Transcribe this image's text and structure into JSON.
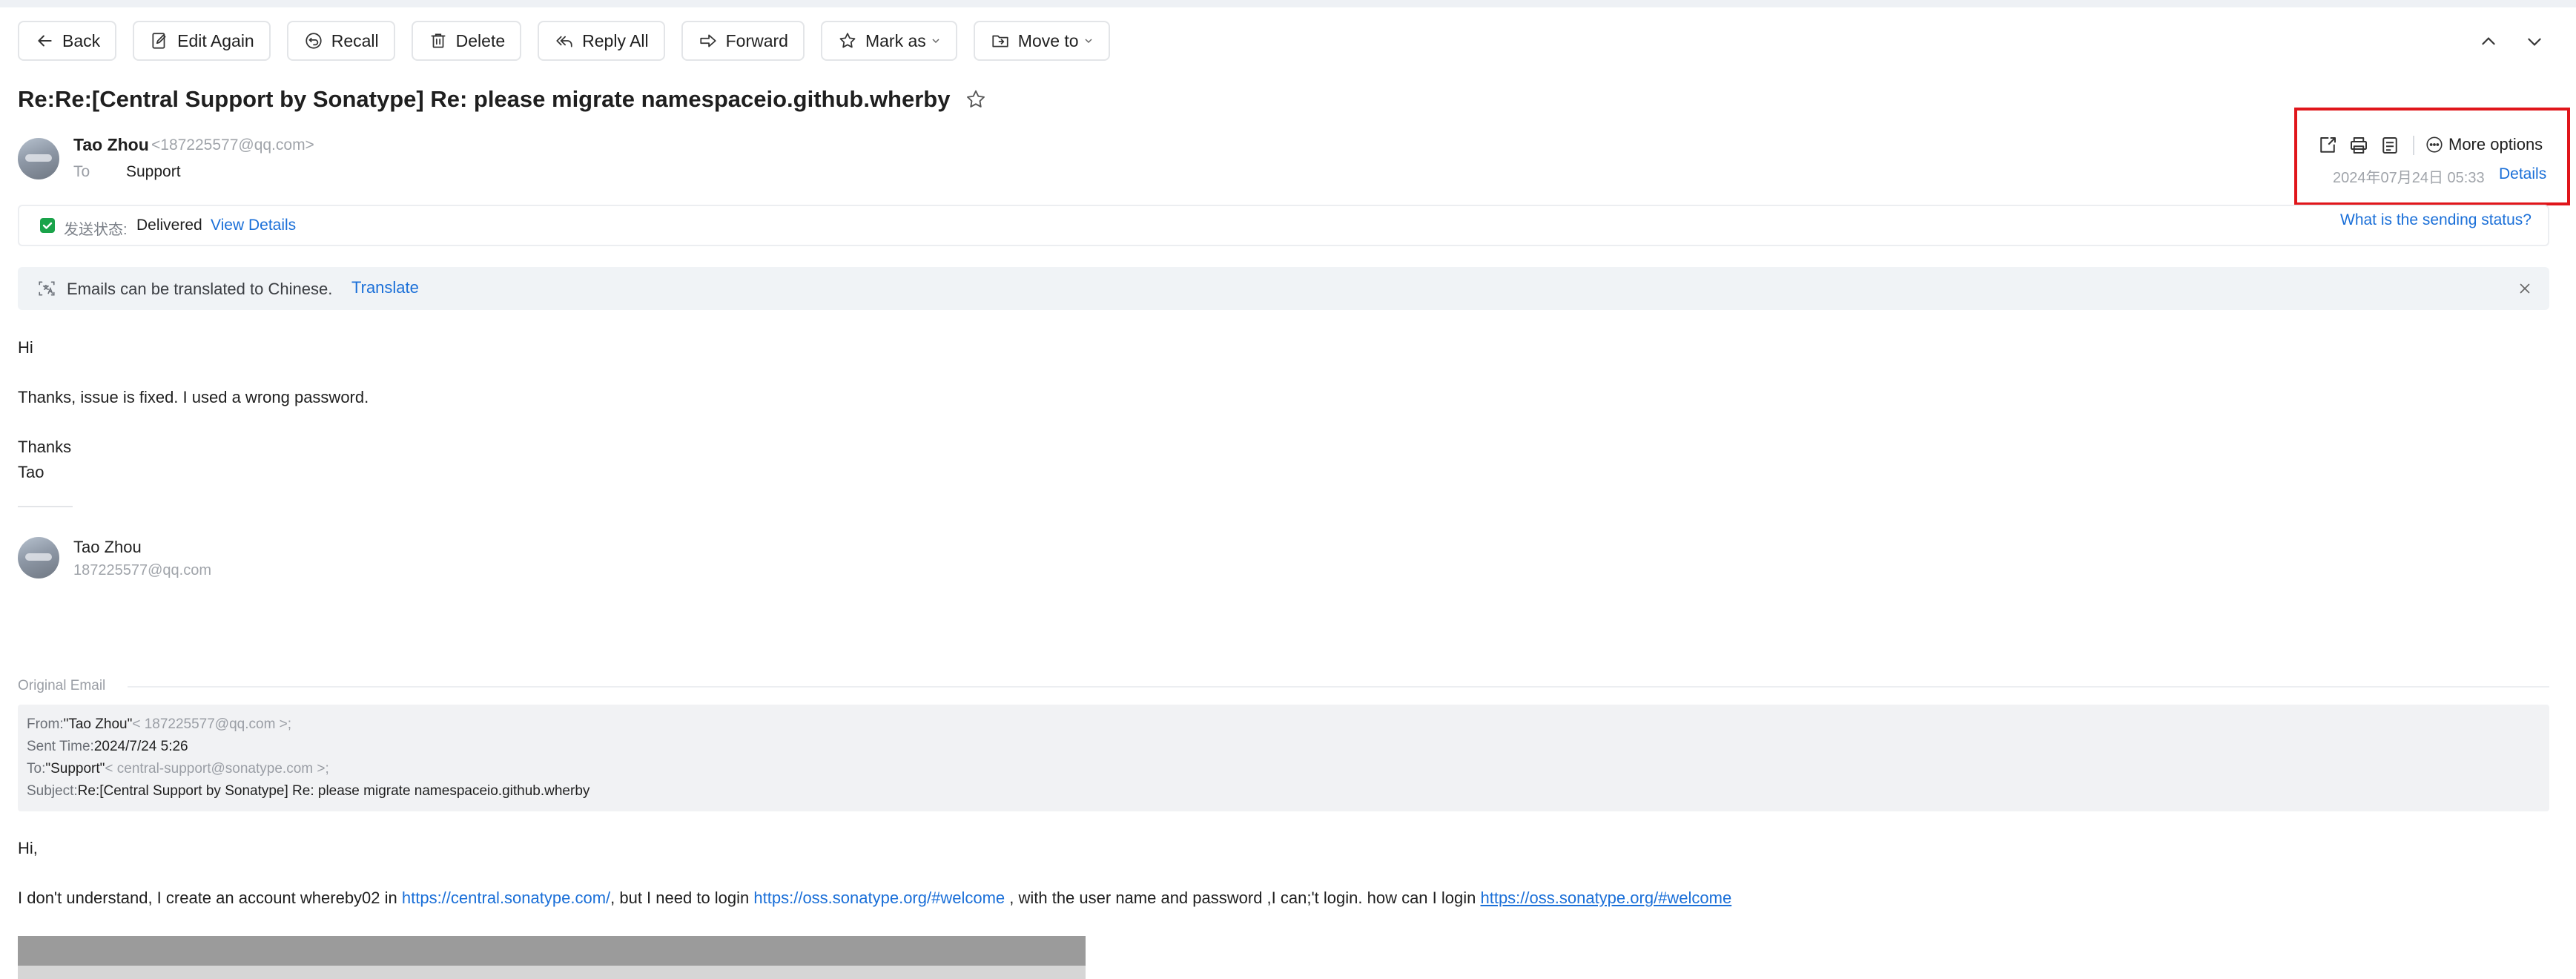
{
  "toolbar": {
    "back": "Back",
    "edit_again": "Edit Again",
    "recall": "Recall",
    "delete": "Delete",
    "reply_all": "Reply All",
    "forward": "Forward",
    "mark_as": "Mark as",
    "move_to": "Move to"
  },
  "email": {
    "subject": "Re:Re:[Central Support by Sonatype] Re: please migrate namespaceio.github.wherby",
    "sender_name": "Tao Zhou",
    "sender_email": "<187225577@qq.com>",
    "to_label": "To",
    "to_value": "Support",
    "more_options": "More options",
    "date": "2024年07月24日 05:33",
    "details": "Details"
  },
  "status": {
    "label": "发送状态:",
    "value": "Delivered",
    "view_details": "View Details",
    "sending_status_link": "What is the sending status?"
  },
  "translate": {
    "text": "Emails can be translated to Chinese.",
    "link": "Translate"
  },
  "body": {
    "greeting": "Hi",
    "line1": "Thanks, issue is fixed. I used a wrong password.",
    "thanks": "Thanks",
    "name": "Tao"
  },
  "signature": {
    "name": "Tao Zhou",
    "email": "187225577@qq.com"
  },
  "original": {
    "label": "Original Email",
    "from_key": "From:",
    "from_name": "\"Tao Zhou\"",
    "from_email": "< 187225577@qq.com >;",
    "sent_key": "Sent Time:",
    "sent_value": "2024/7/24 5:26",
    "to_key": "To:",
    "to_name": "\"Support\"",
    "to_email": "< central-support@sonatype.com >;",
    "subject_key": "Subject:",
    "subject_value": "Re:[Central Support by Sonatype] Re: please migrate namespaceio.github.wherby"
  },
  "quoted": {
    "greeting": "Hi,",
    "part1": "I don't understand, I create an account whereby02 in ",
    "link1": "https://central.sonatype.com/",
    "part2": ", but I need to login ",
    "link2": "https://oss.sonatype.org/#welcome",
    "part3": " , with the user name and password ,I can;'t login. how can I login  ",
    "link3": "https://oss.sonatype.org/#welcome"
  },
  "colors": {
    "accent": "#1a6fd8",
    "highlight_box": "#e0161b",
    "delivered_check": "#1aa34a"
  },
  "icons": {
    "back": "arrow-left-icon",
    "edit_again": "edit-icon",
    "recall": "recall-icon",
    "delete": "trash-icon",
    "reply_all": "reply-all-icon",
    "forward": "forward-icon",
    "mark_as": "star-icon",
    "move_to": "folder-icon"
  }
}
